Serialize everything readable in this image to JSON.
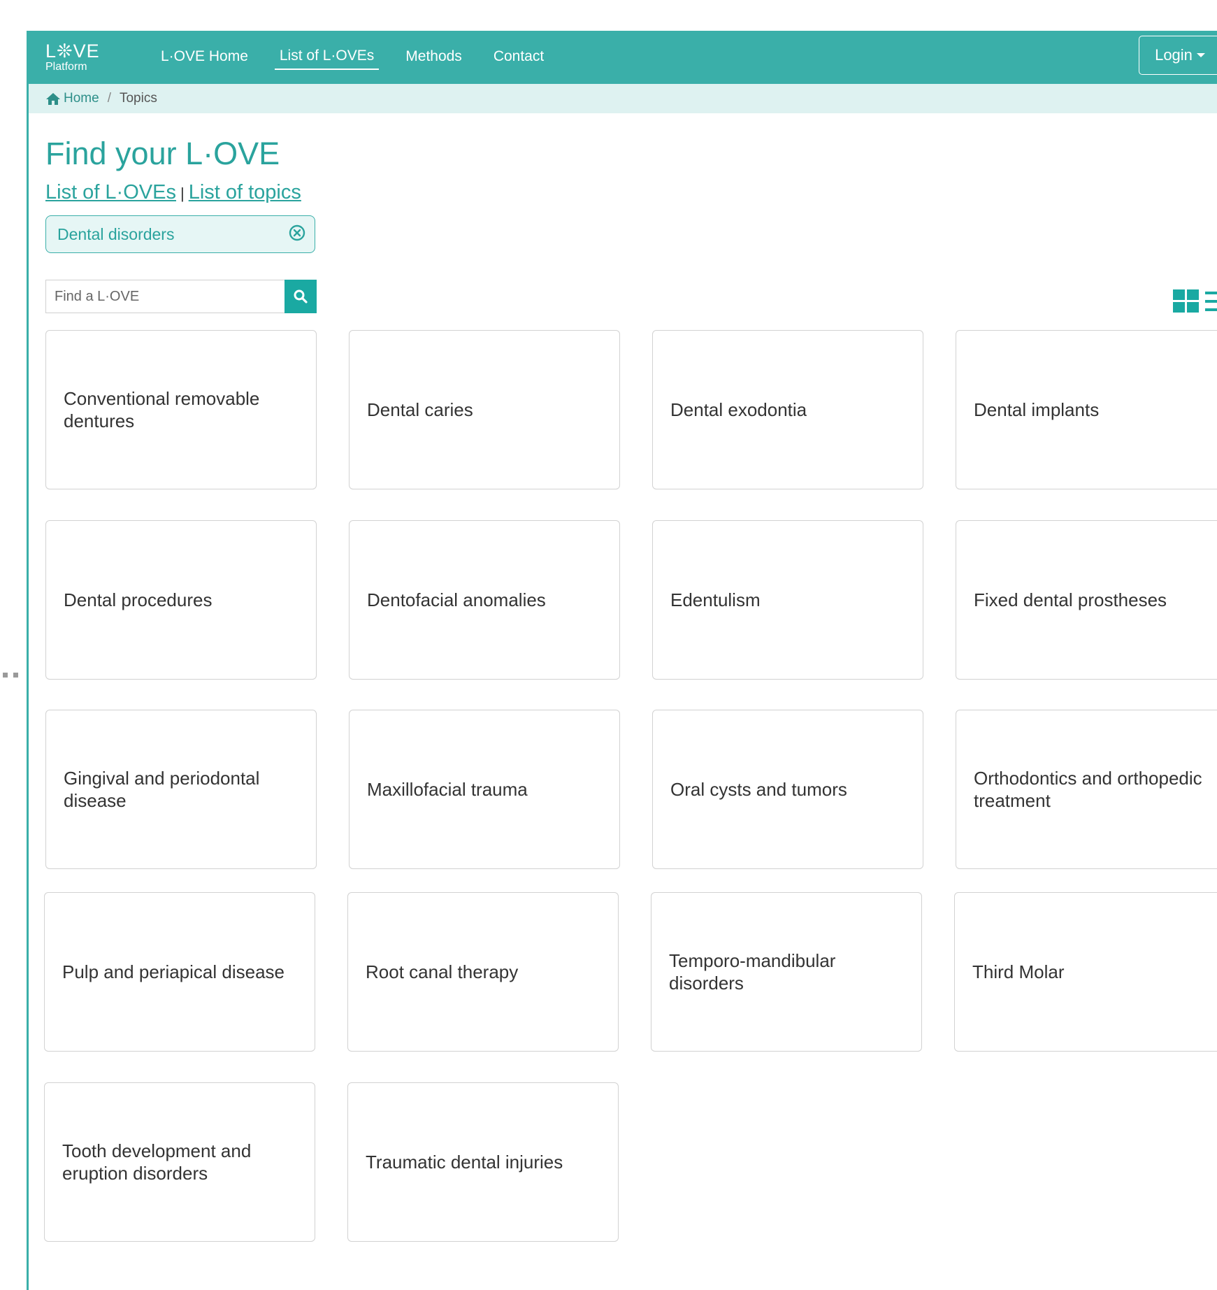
{
  "nav": {
    "logo_mark": "L❊VE",
    "logo_sub": "Platform",
    "links": [
      "L·OVE Home",
      "List of L·OVEs",
      "Methods",
      "Contact"
    ],
    "login_label": "Login"
  },
  "breadcrumb": {
    "home": "Home",
    "current": "Topics"
  },
  "page": {
    "title": "Find your L·OVE",
    "link_loves": "List of L·OVEs",
    "separator": "|",
    "link_topics": "List of topics"
  },
  "filter": {
    "label": "Dental disorders"
  },
  "search": {
    "placeholder": "Find a L·OVE"
  },
  "topics": [
    "Conventional removable dentures",
    "Dental caries",
    "Dental exodontia",
    "Dental implants",
    "Dental procedures",
    "Dentofacial anomalies",
    "Edentulism",
    "Fixed dental prostheses",
    "Gingival and periodontal disease",
    "Maxillofacial trauma",
    "Oral cysts and tumors",
    "Orthodontics and orthopedic treatment",
    "Pulp and periapical disease",
    "Root canal therapy",
    "Temporo-mandibular disorders",
    "Third Molar",
    "Tooth development and eruption disorders",
    "Traumatic dental injuries"
  ],
  "colors": {
    "accent": "#3aafa9",
    "breadcrumb_bg": "#def2f1",
    "link": "#2aa39d"
  }
}
